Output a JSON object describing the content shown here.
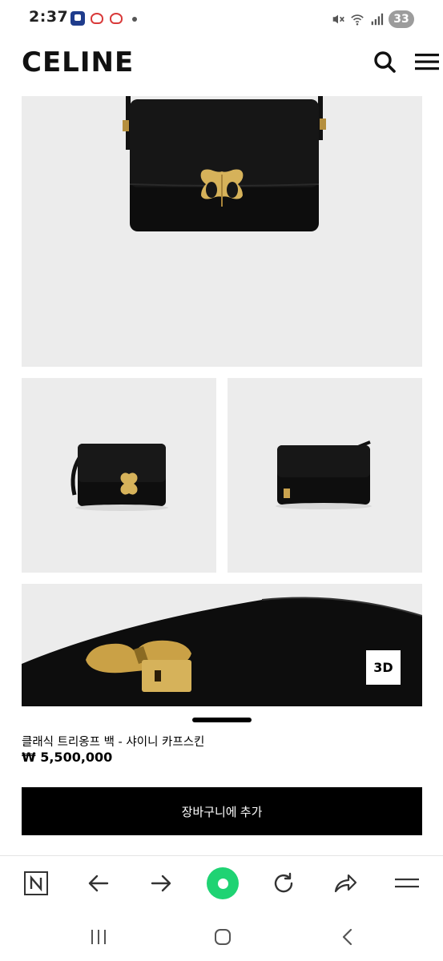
{
  "status_bar": {
    "time": "2:37",
    "battery": "33"
  },
  "header": {
    "logo": "CELINE"
  },
  "gallery": {
    "badge_3d": "3D"
  },
  "product": {
    "name": "클래식 트리옹프 백 - 샤이니 카프스킨",
    "price": "₩ 5,500,000",
    "add_to_cart_label": "장바구니에 추가"
  },
  "browser_toolbar": {
    "n_label": "N",
    "icons": [
      "n-icon",
      "back-arrow-icon",
      "forward-arrow-icon",
      "home-dot-icon",
      "reload-icon",
      "share-icon",
      "menu-icon"
    ],
    "accent_color": "#1fd373"
  },
  "system_nav": {
    "icons": [
      "recent-apps-icon",
      "home-icon",
      "back-icon"
    ]
  }
}
